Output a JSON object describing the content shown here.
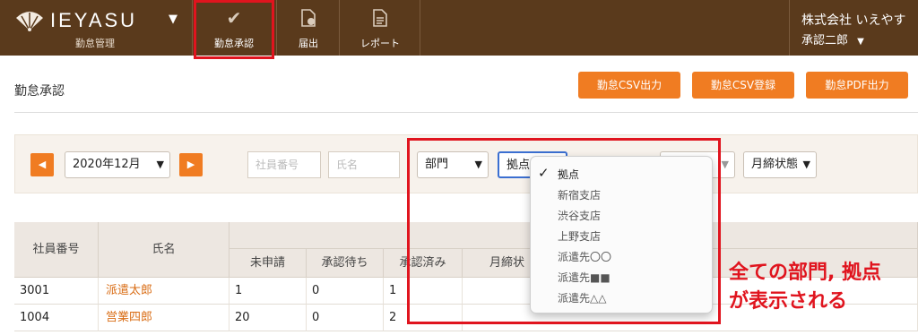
{
  "header": {
    "brand": "IEYASU",
    "brand_sub": "勤怠管理",
    "nav": [
      {
        "label": "勤怠承認",
        "icon": "check-icon"
      },
      {
        "label": "届出",
        "icon": "document-add-icon"
      },
      {
        "label": "レポート",
        "icon": "report-icon"
      }
    ],
    "company": "株式会社 いえやす",
    "user": "承認二郎"
  },
  "page": {
    "title": "勤怠承認",
    "buttons": [
      "勤怠CSV出力",
      "勤怠CSV登録",
      "勤怠PDF出力"
    ]
  },
  "filters": {
    "month": "2020年12月",
    "employee_no_placeholder": "社員番号",
    "name_placeholder": "氏名",
    "department": "部門",
    "base": "拠点",
    "monthly_close": "月締状態"
  },
  "dropdown": {
    "items": [
      "拠点",
      "新宿支店",
      "渋谷支店",
      "上野支店",
      "派遣先〇〇",
      "派遣先■■",
      "派遣先△△"
    ],
    "selected": "拠点"
  },
  "table": {
    "headers": [
      "社員番号",
      "氏名",
      "未申請",
      "承認待ち",
      "承認済み",
      "月締状"
    ],
    "rows": [
      {
        "employee_no": "3001",
        "name": "派遣太郎",
        "unsubmitted": "1",
        "pending": "0",
        "approved": "1"
      },
      {
        "employee_no": "1004",
        "name": "営業四郎",
        "unsubmitted": "20",
        "pending": "0",
        "approved": "2"
      }
    ]
  },
  "annotation": {
    "line1": "全ての部門, 拠点",
    "line2": "が表示される"
  },
  "colors": {
    "header_bg": "#5a3a1c",
    "accent": "#f07c22",
    "highlight": "#e0141e"
  }
}
